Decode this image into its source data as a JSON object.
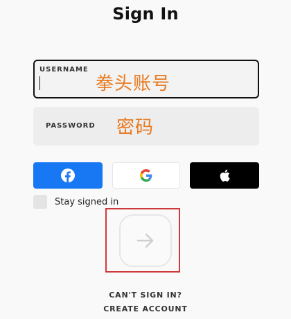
{
  "page": {
    "title": "Sign In"
  },
  "form": {
    "username": {
      "label": "USERNAME",
      "overlay": "拳头账号"
    },
    "password": {
      "label": "PASSWORD",
      "overlay": "密码"
    }
  },
  "social": {
    "facebook": {
      "icon": "facebook-icon",
      "color": "#1877f2"
    },
    "google": {
      "icon": "google-icon"
    },
    "apple": {
      "icon": "apple-icon",
      "color": "#000000"
    }
  },
  "stay_signed_in": {
    "label": "Stay signed in",
    "checked": false
  },
  "submit": {
    "icon": "arrow-right-icon"
  },
  "links": {
    "cant_sign_in": "CAN'T SIGN IN?",
    "create_account": "CREATE ACCOUNT"
  },
  "colors": {
    "annotation": "#e87a20",
    "highlight": "#d0393a"
  }
}
